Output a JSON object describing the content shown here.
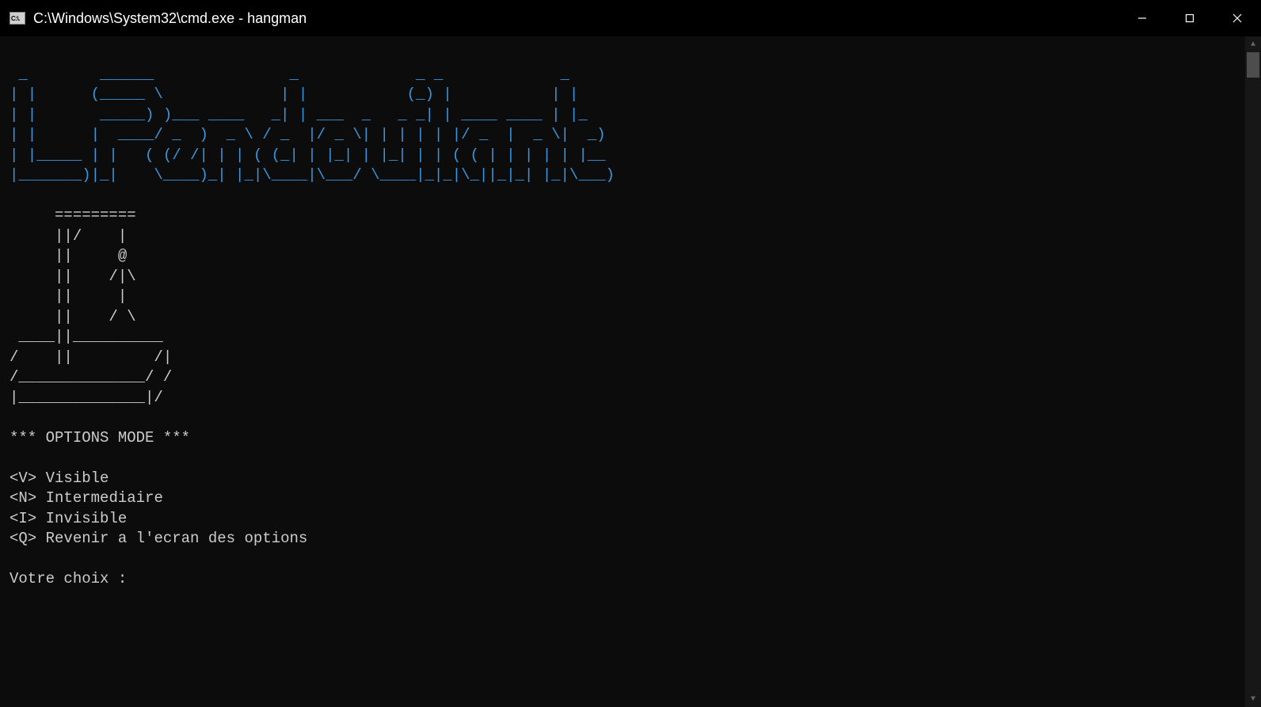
{
  "titlebar": {
    "icon_text": "C:\\.",
    "title": "C:\\Windows\\System32\\cmd.exe - hangman"
  },
  "ascii_title": " _        ______               _             _ _             _\n| |      (_____ \\             | |           (_) |           | |\n| |       _____) )___ ____   _| | ___  _   _ _| | ____ ____ | |_\n| |      |  ____/ _  )  _ \\ / _  |/ _ \\| | | | | |/ _  |  _ \\|  _)\n| |_____ | |   ( (/ /| | | ( (_| | |_| | |_| | | ( ( | | | | | |__\n|_______)|_|    \\____)_| |_|\\____|\\___/ \\____|_|_|\\_||_|_| |_|\\___)",
  "ascii_hangman": "     =========\n     ||/    |\n     ||     @\n     ||    /|\\\n     ||     |\n     ||    / \\\n ____||__________\n/    ||         /|\n/______________/ /\n|______________|/",
  "menu": {
    "header": "*** OPTIONS MODE ***",
    "items": [
      {
        "key": "<V>",
        "label": "Visible"
      },
      {
        "key": "<N>",
        "label": "Intermediaire"
      },
      {
        "key": "<I>",
        "label": "Invisible"
      },
      {
        "key": "<Q>",
        "label": "Revenir a l'ecran des options"
      }
    ],
    "prompt": "Votre choix :"
  }
}
